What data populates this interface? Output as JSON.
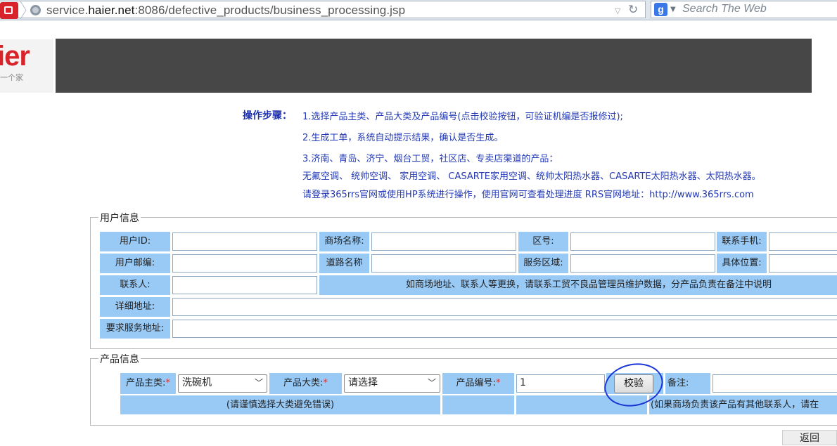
{
  "browser": {
    "url_prefix": "service.",
    "url_host": "haier.net",
    "url_rest": ":8086/defective_products/business_processing.jsp",
    "search_placeholder": "Search The Web"
  },
  "logo": {
    "text": "ier",
    "subtext": "一个家"
  },
  "instructions": {
    "label": "操作步骤：",
    "lines": [
      "1.选择产品主类、产品大类及产品编号(点击校验按钮，可验证机编是否报修过);",
      "2.生成工单，系统自动提示结果，确认是否生成。",
      "3.济南、青岛、济宁、烟台工贸，社区店、专卖店渠道的产品：",
      "无氟空调、 统帅空调、 家用空调、 CASARTE家用空调、统帅太阳热水器、CASARTE太阳热水器、太阳热水器。",
      "请登录365rrs官网或使用HP系统进行操作，使用官网可查看处理进度 RRS官网地址：http://www.365rrs.com"
    ]
  },
  "user_info": {
    "legend": "用户信息",
    "labels": {
      "user_id": "用户ID:",
      "mall_name": "商场名称:",
      "area_code": "区号:",
      "mobile": "联系手机:",
      "postcode": "用户邮编:",
      "road": "道路名称",
      "service_area": "服务区域:",
      "location": "具体位置:",
      "contact": "联系人:",
      "address": "详细地址:",
      "service_address": "要求服务地址:"
    },
    "notice": "如商场地址、联系人等更换，请联系工贸不良品管理员维护数据，分产品负责在备注中说明"
  },
  "product_info": {
    "legend": "产品信息",
    "main_category_label": "产品主类:",
    "main_category_value": "洗碗机",
    "category_label": "产品大类:",
    "category_value": "请选择",
    "product_code_label": "产品编号:",
    "product_code_value": "1",
    "verify_button": "校验",
    "remark_label": "备注:",
    "hint_category": "(请谨慎选择大类避免错误)",
    "hint_remark": "(如果商场负责该产品有其他联系人，请在"
  },
  "footer": {
    "back_button": "返回"
  }
}
